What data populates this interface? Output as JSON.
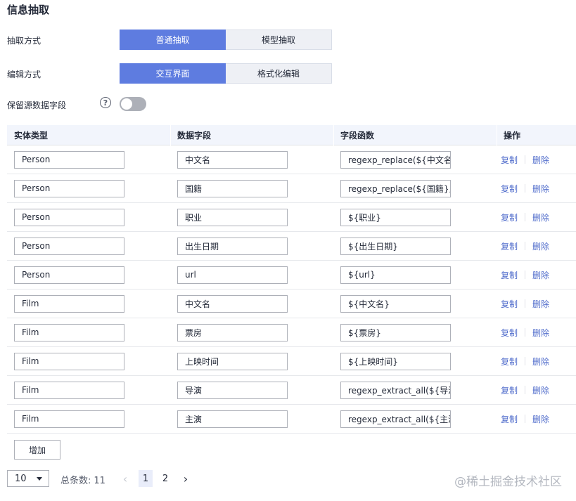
{
  "page_title": "信息抽取",
  "extract_mode": {
    "label": "抽取方式",
    "options": [
      "普通抽取",
      "模型抽取"
    ],
    "selected": "普通抽取"
  },
  "edit_mode": {
    "label": "编辑方式",
    "options": [
      "交互界面",
      "格式化编辑"
    ],
    "selected": "交互界面"
  },
  "keep_source": {
    "label": "保留源数据字段",
    "help_icon": "question-circle-icon",
    "enabled": false
  },
  "table": {
    "headers": [
      "实体类型",
      "数据字段",
      "字段函数",
      "操作"
    ],
    "actions": {
      "copy": "复制",
      "delete": "删除"
    },
    "rows": [
      {
        "entity": "Person",
        "field": "中文名",
        "func": "regexp_replace(${中文名},"
      },
      {
        "entity": "Person",
        "field": "国籍",
        "func": "regexp_replace(${国籍}, '"
      },
      {
        "entity": "Person",
        "field": "职业",
        "func": "${职业}"
      },
      {
        "entity": "Person",
        "field": "出生日期",
        "func": "${出生日期}"
      },
      {
        "entity": "Person",
        "field": "url",
        "func": "${url}"
      },
      {
        "entity": "Film",
        "field": "中文名",
        "func": "${中文名}"
      },
      {
        "entity": "Film",
        "field": "票房",
        "func": "${票房}"
      },
      {
        "entity": "Film",
        "field": "上映时间",
        "func": "${上映时间}"
      },
      {
        "entity": "Film",
        "field": "导演",
        "func": "regexp_extract_all(${导演"
      },
      {
        "entity": "Film",
        "field": "主演",
        "func": "regexp_extract_all(${主演"
      }
    ]
  },
  "add_button": "增加",
  "pagination": {
    "page_size": "10",
    "total_label": "总条数:",
    "total": "11",
    "pages": [
      "1",
      "2"
    ],
    "current": "1"
  },
  "watermark": "@稀土掘金技术社区"
}
